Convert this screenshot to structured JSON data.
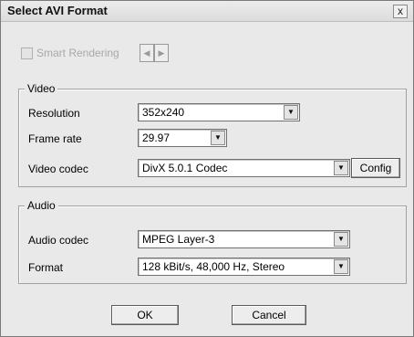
{
  "window": {
    "title": "Select AVI Format",
    "close_glyph": "x"
  },
  "smart_rendering": {
    "label": "Smart Rendering",
    "checked": false,
    "enabled": false
  },
  "nav": {
    "prev_glyph": "◀",
    "next_glyph": "▶"
  },
  "video": {
    "group_label": "Video",
    "resolution_label": "Resolution",
    "resolution_value": "352x240",
    "frame_rate_label": "Frame rate",
    "frame_rate_value": "29.97",
    "codec_label": "Video codec",
    "codec_value": "DivX 5.0.1 Codec",
    "config_label": "Config"
  },
  "audio": {
    "group_label": "Audio",
    "codec_label": "Audio codec",
    "codec_value": "MPEG Layer-3",
    "format_label": "Format",
    "format_value": "128 kBit/s, 48,000 Hz, Stereo"
  },
  "buttons": {
    "ok_label": "OK",
    "cancel_label": "Cancel"
  },
  "icons": {
    "dropdown": "chevron-down-icon"
  }
}
